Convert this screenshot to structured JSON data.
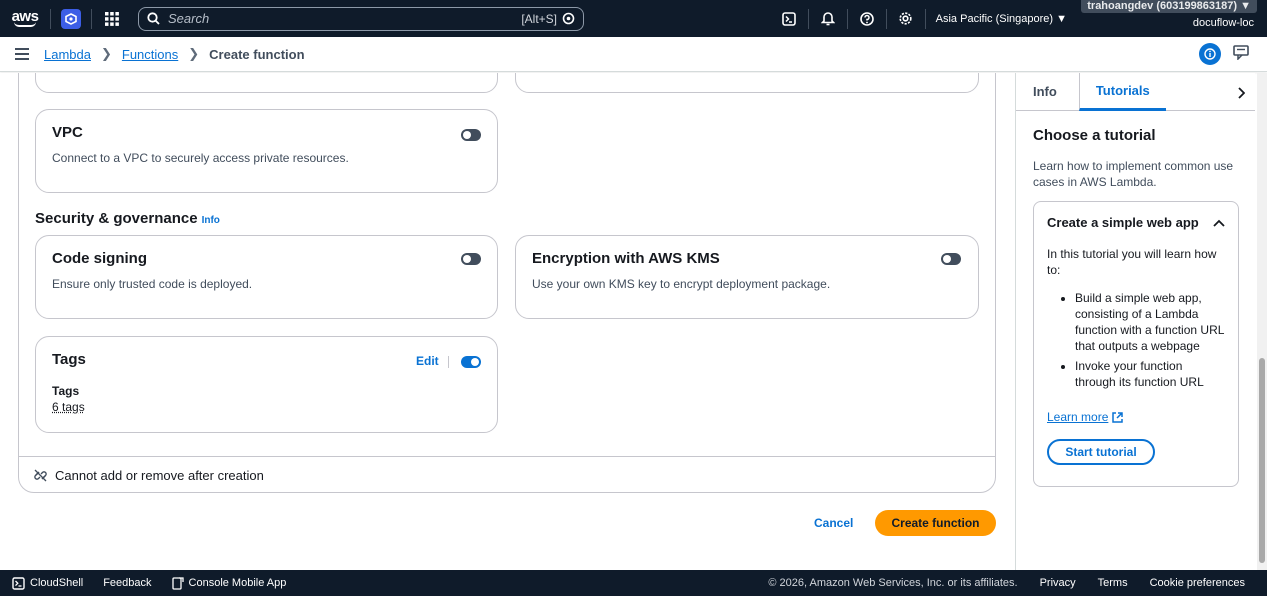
{
  "topnav": {
    "logo": "aws",
    "search_placeholder": "Search",
    "search_shortcut": "[Alt+S]",
    "region": "Asia Pacific (Singapore) ▼",
    "account": "trahoangdev (603199863187) ▼",
    "alias": "docuflow-loc",
    "icons": [
      "apps-grid-icon",
      "cloudshell-icon",
      "bell-icon",
      "help-icon",
      "gear-icon"
    ]
  },
  "breadcrumb": {
    "items": [
      "Lambda",
      "Functions"
    ],
    "current": "Create function"
  },
  "main": {
    "vpc": {
      "title": "VPC",
      "description": "Connect to a VPC to securely access private resources.",
      "enabled": false
    },
    "security_section": {
      "title": "Security & governance",
      "info": "Info"
    },
    "code_signing": {
      "title": "Code signing",
      "description": "Ensure only trusted code is deployed.",
      "enabled": false
    },
    "encryption": {
      "title": "Encryption with AWS KMS",
      "description": "Use your own KMS key to encrypt deployment package.",
      "enabled": false
    },
    "tags": {
      "title": "Tags",
      "edit": "Edit",
      "label": "Tags",
      "value": "6 tags",
      "enabled": true
    },
    "footer_note": "Cannot add or remove after creation",
    "cancel": "Cancel",
    "create": "Create function"
  },
  "tutorial_panel": {
    "tabs": [
      "Info",
      "Tutorials"
    ],
    "active_tab": "Tutorials",
    "title": "Choose a tutorial",
    "description": "Learn how to implement common use cases in AWS Lambda.",
    "card": {
      "title": "Create a simple web app",
      "intro": "In this tutorial you will learn how to:",
      "steps": [
        "Build a simple web app, consisting of a Lambda function with a function URL that outputs a webpage",
        "Invoke your function through its function URL"
      ],
      "learn_more": "Learn more",
      "start": "Start tutorial"
    }
  },
  "footer": {
    "cloudshell": "CloudShell",
    "feedback": "Feedback",
    "mobile": "Console Mobile App",
    "copyright": "© 2026, Amazon Web Services, Inc. or its affiliates.",
    "privacy": "Privacy",
    "terms": "Terms",
    "cookies": "Cookie preferences"
  },
  "colors": {
    "nav_bg": "#0f1b2a",
    "link": "#0972d3",
    "primary_button": "#ff9900"
  }
}
